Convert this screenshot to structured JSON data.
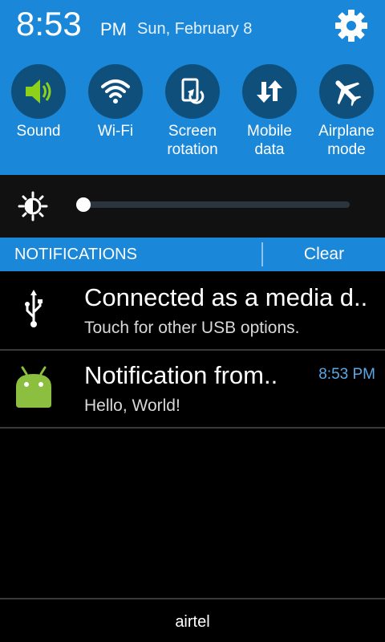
{
  "status": {
    "time": "8:53",
    "ampm": "PM",
    "date": "Sun, February 8"
  },
  "quick_settings": [
    {
      "label": "Sound",
      "icon": "sound-icon"
    },
    {
      "label": "Wi-Fi",
      "icon": "wifi-icon"
    },
    {
      "label": "Screen rotation",
      "icon": "screen-rotation-icon"
    },
    {
      "label": "Mobile data",
      "icon": "mobile-data-icon"
    },
    {
      "label": "Airplane mode",
      "icon": "airplane-icon"
    }
  ],
  "brightness": {
    "icon": "brightness-icon",
    "level": 0.0
  },
  "notifications_header": {
    "title": "NOTIFICATIONS",
    "clear_label": "Clear"
  },
  "notifications": [
    {
      "icon": "usb-icon",
      "title": "Connected as a media d..",
      "text": "Touch for other USB options.",
      "time": ""
    },
    {
      "icon": "android-icon",
      "title": "Notification from..",
      "text": "Hello, World!",
      "time": "8:53 PM"
    }
  ],
  "footer": {
    "carrier": "airtel"
  },
  "colors": {
    "accent": "#1b87d8",
    "toggle_bg": "#0f4f7c",
    "sound_active": "#8ed11b",
    "android_green": "#8cbf3f",
    "time_blue": "#5aa8e6"
  }
}
